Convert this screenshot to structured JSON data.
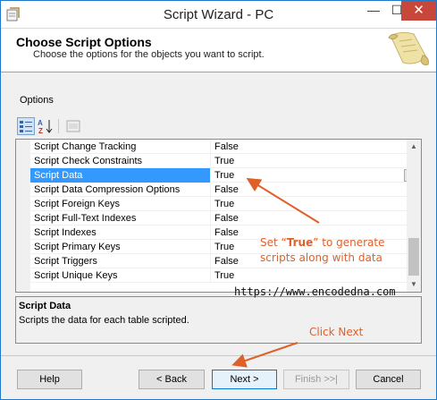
{
  "window": {
    "title": "Script Wizard - PC",
    "controls": {
      "minimize": "—",
      "maximize": "☐",
      "close": "✕"
    }
  },
  "banner": {
    "title": "Choose Script Options",
    "subtitle": "Choose the options for the objects you want to script."
  },
  "options_label": "Options",
  "grid": {
    "selected_index": 2,
    "rows": [
      {
        "name": "Script Change Tracking",
        "value": "False"
      },
      {
        "name": "Script Check Constraints",
        "value": "True"
      },
      {
        "name": "Script Data",
        "value": "True"
      },
      {
        "name": "Script Data Compression Options",
        "value": "False"
      },
      {
        "name": "Script Foreign Keys",
        "value": "True"
      },
      {
        "name": "Script Full-Text Indexes",
        "value": "False"
      },
      {
        "name": "Script Indexes",
        "value": "False"
      },
      {
        "name": "Script Primary Keys",
        "value": "True"
      },
      {
        "name": "Script Triggers",
        "value": "False"
      },
      {
        "name": "Script Unique Keys",
        "value": "True"
      }
    ]
  },
  "description": {
    "title": "Script Data",
    "text": "Scripts the data for each table scripted."
  },
  "buttons": {
    "help": "Help",
    "back": "< Back",
    "next": "Next >",
    "finish": "Finish >>|",
    "cancel": "Cancel"
  },
  "annotations": {
    "data_prefix": "Set “",
    "data_bold": "True",
    "data_suffix": "” to generate",
    "data_line2": "scripts along with data",
    "next": "Click Next",
    "watermark": "https://www.encodedna.com"
  },
  "colors": {
    "selection": "#3399ff",
    "annotation": "#e0602a",
    "close_button": "#c7473a",
    "accent_border": "#1f78c8"
  },
  "icons": [
    "app-icon",
    "categorized-icon",
    "alphabetical-icon",
    "property-pages-icon",
    "scroll-parchment-icon",
    "dropdown-arrow-icon"
  ]
}
